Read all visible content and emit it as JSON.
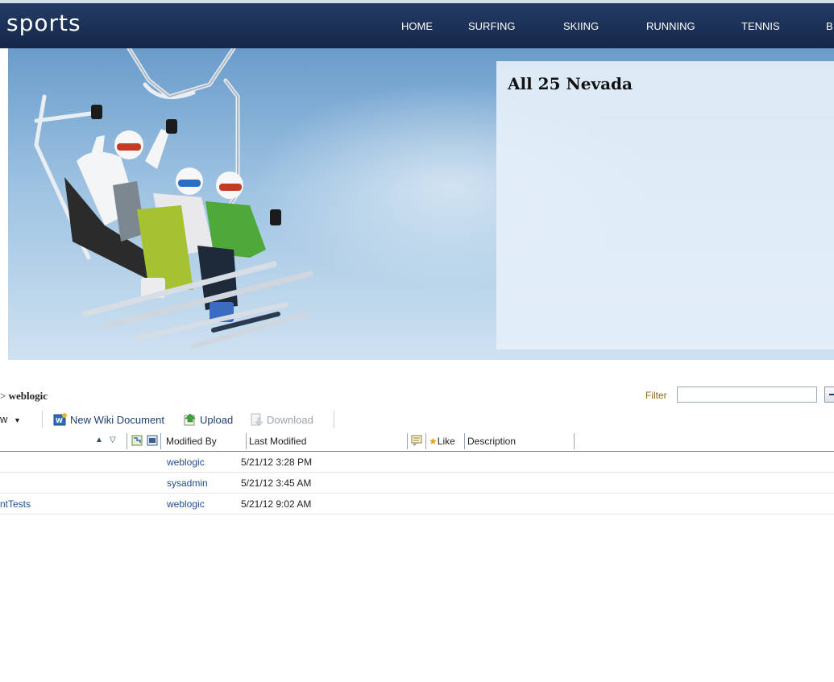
{
  "header": {
    "brand": "sports",
    "nav": [
      "HOME",
      "SURFING",
      "SKIING",
      "RUNNING",
      "TENNIS",
      "B"
    ]
  },
  "hero": {
    "title": "All 25 Nevada"
  },
  "breadcrumb": {
    "prefix": ">",
    "current": "weblogic"
  },
  "filter": {
    "label": "Filter",
    "value": ""
  },
  "toolbar": {
    "view_label": "w",
    "new_wiki_label": "New Wiki Document",
    "upload_label": "Upload",
    "download_label": "Download"
  },
  "table": {
    "columns": [
      "Modified By",
      "Last Modified",
      "Like",
      "Description"
    ],
    "rows": [
      {
        "name": "",
        "modified_by": "weblogic",
        "last_modified": "5/21/12 3:28 PM"
      },
      {
        "name": "",
        "modified_by": "sysadmin",
        "last_modified": "5/21/12 3:45 AM"
      },
      {
        "name": "ntTests",
        "modified_by": "weblogic",
        "last_modified": "5/21/12 9:02 AM"
      }
    ]
  },
  "icons": {
    "sort_asc": "sort-ascending-icon",
    "sort_desc": "sort-descending-icon",
    "wiki": "wiki-icon",
    "upload": "upload-icon",
    "download": "download-icon",
    "comment": "comment-icon",
    "like": "star-icon"
  },
  "colors": {
    "header_bg": "#1c3157",
    "link": "#1f4e8c",
    "filter_label": "#8a6c1a"
  }
}
